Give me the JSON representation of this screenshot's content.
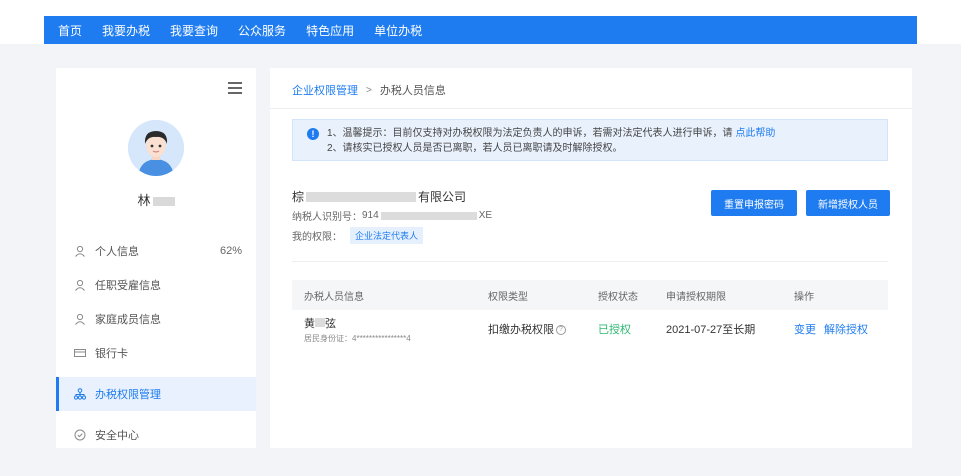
{
  "nav": {
    "items": [
      "首页",
      "我要办税",
      "我要查询",
      "公众服务",
      "特色应用",
      "单位办税"
    ]
  },
  "user": {
    "name": "林"
  },
  "sidebar": {
    "items": [
      {
        "label": "个人信息",
        "icon": "user-icon",
        "extra": "62%"
      },
      {
        "label": "任职受雇信息",
        "icon": "user-icon"
      },
      {
        "label": "家庭成员信息",
        "icon": "user-icon"
      },
      {
        "label": "银行卡",
        "icon": "card-icon"
      },
      {
        "label": "办税权限管理",
        "icon": "org-icon",
        "active": true
      },
      {
        "label": "安全中心",
        "icon": "shield-icon"
      }
    ]
  },
  "breadcrumb": {
    "parent": "企业权限管理",
    "separator": ">",
    "current": "办税人员信息"
  },
  "notice": {
    "line1_prefix": "1、温馨提示：目前仅支持对办税权限为法定负责人的申诉，若需对法定代表人进行申诉，请 ",
    "line1_link": "点此帮助",
    "line2": "2、请核实已授权人员是否已离职，若人员已离职请及时解除授权。"
  },
  "company": {
    "name_prefix": "棕",
    "name_suffix": "有限公司",
    "taxid_label": "纳税人识别号：",
    "taxid_prefix": "914",
    "taxid_suffix": "XE",
    "perm_label": "我的权限：",
    "perm_value": "企业法定代表人"
  },
  "buttons": {
    "reset": "重置申报密码",
    "add": "新增授权人员"
  },
  "table": {
    "headers": [
      "办税人员信息",
      "权限类型",
      "授权状态",
      "申请授权期限",
      "操作"
    ],
    "rows": [
      {
        "name_prefix": "黄",
        "name_suffix": "弦",
        "id_label": "居民身份证：",
        "id_value": "4****************4",
        "perm_type": "扣缴办税权限",
        "status": "已授权",
        "period": "2021-07-27至长期",
        "op_change": "变更",
        "op_revoke": "解除授权"
      }
    ]
  },
  "colors": {
    "primary": "#1e7cf0",
    "success": "#2eb872"
  }
}
